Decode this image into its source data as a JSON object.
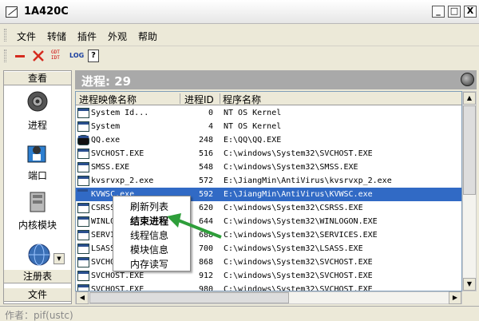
{
  "window": {
    "title": "1A420C",
    "minimize": "_",
    "maximize": "□",
    "close": "X"
  },
  "menu": [
    "文件",
    "转储",
    "插件",
    "外观",
    "帮助"
  ],
  "toolbar": {
    "gdt_top": "GDT",
    "gdt_bottom": "IDT",
    "log": "LOG",
    "help": "?"
  },
  "sidebar": {
    "view_header": "查看",
    "items": [
      "进程",
      "端口",
      "内核模块"
    ],
    "registry": "注册表",
    "file": "文件"
  },
  "main": {
    "header": "进程: 29"
  },
  "table": {
    "columns": [
      "进程映像名称",
      "进程ID",
      "程序名称"
    ],
    "rows": [
      {
        "name": "System Id...",
        "pid": "0",
        "path": "NT OS Kernel",
        "icon": "window-icon"
      },
      {
        "name": "System",
        "pid": "4",
        "path": "NT OS Kernel",
        "icon": "window-icon"
      },
      {
        "name": "QQ.exe",
        "pid": "248",
        "path": "E:\\QQ\\QQ.EXE",
        "icon": "qq-penguin-icon"
      },
      {
        "name": "SVCHOST.EXE",
        "pid": "516",
        "path": "C:\\windows\\System32\\SVCHOST.EXE",
        "icon": "window-icon"
      },
      {
        "name": "SMSS.EXE",
        "pid": "548",
        "path": "C:\\windows\\System32\\SMSS.EXE",
        "icon": "window-icon"
      },
      {
        "name": "kvsrvxp_2.exe",
        "pid": "572",
        "path": "E:\\JiangMin\\AntiVirus\\kvsrvxp_2.exe",
        "icon": "window-icon"
      },
      {
        "name": "KVWSC.exe",
        "pid": "592",
        "path": "E:\\JiangMin\\AntiVirus\\KVWSC.exe",
        "icon": "kv-icon",
        "selected": true
      },
      {
        "name": "CSRSS",
        "pid": "620",
        "path": "C:\\windows\\System32\\CSRSS.EXE",
        "icon": "window-icon"
      },
      {
        "name": "WINLOG",
        "pid": "644",
        "path": "C:\\windows\\System32\\WINLOGON.EXE",
        "icon": "window-icon"
      },
      {
        "name": "SERVI",
        "pid": "688",
        "path": "C:\\windows\\System32\\SERVICES.EXE",
        "icon": "window-icon"
      },
      {
        "name": "LSASS",
        "pid": "700",
        "path": "C:\\windows\\System32\\LSASS.EXE",
        "icon": "window-icon"
      },
      {
        "name": "SVCHO",
        "pid": "868",
        "path": "C:\\windows\\System32\\SVCHOST.EXE",
        "icon": "window-icon"
      },
      {
        "name": "SVCHOST.EXE",
        "pid": "912",
        "path": "C:\\windows\\System32\\SVCHOST.EXE",
        "icon": "window-icon"
      },
      {
        "name": "SVCHOST.EXE",
        "pid": "980",
        "path": "C:\\windows\\System32\\SVCHOST.EXE",
        "icon": "window-icon"
      }
    ]
  },
  "context_menu": {
    "items": [
      "刷新列表",
      "结束进程",
      "线程信息",
      "模块信息",
      "内存读写"
    ]
  },
  "status": {
    "author": "作者：pif(ustc)"
  },
  "colors": {
    "selection": "#316ac5",
    "header_gray": "#a9a9a9",
    "arrow_green": "#2e9e3a",
    "stop_red": "#d52b1e"
  }
}
